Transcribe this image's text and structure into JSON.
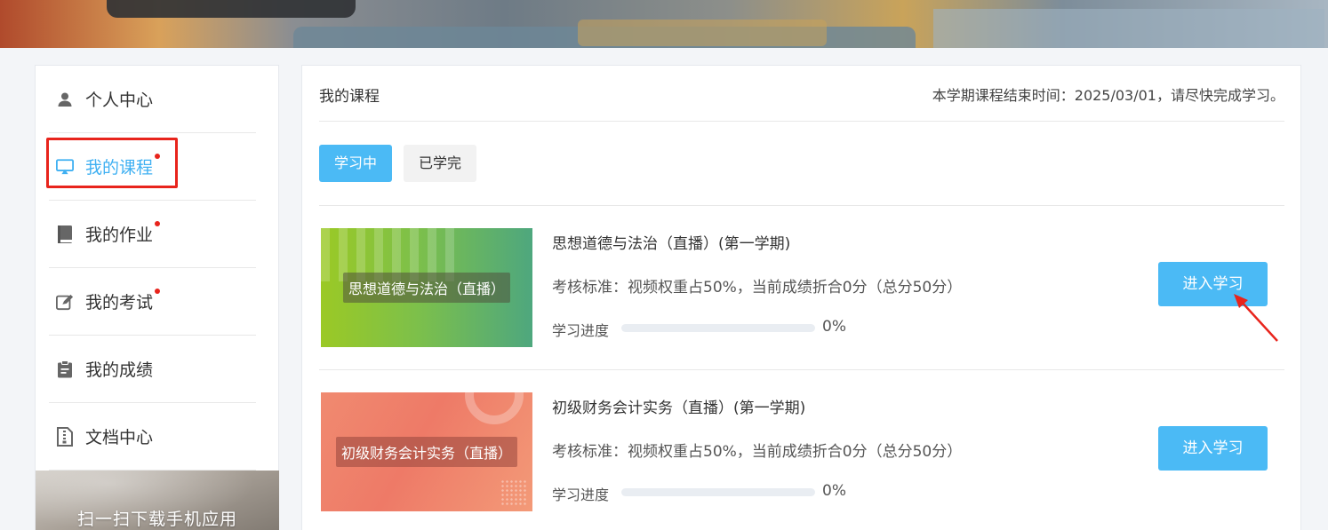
{
  "sidebar": {
    "items": [
      {
        "label": "个人中心",
        "icon": "user-icon",
        "active": false,
        "badge": false
      },
      {
        "label": "我的课程",
        "icon": "screen-icon",
        "active": true,
        "badge": true
      },
      {
        "label": "我的作业",
        "icon": "book-icon",
        "active": false,
        "badge": true
      },
      {
        "label": "我的考试",
        "icon": "edit-icon",
        "active": false,
        "badge": true
      },
      {
        "label": "我的成绩",
        "icon": "clipboard-icon",
        "active": false,
        "badge": false
      },
      {
        "label": "文档中心",
        "icon": "document-icon",
        "active": false,
        "badge": false
      }
    ],
    "qr_text": "扫一扫下载手机应用"
  },
  "main": {
    "title": "我的课程",
    "term_note": "本学期课程结束时间：2025/03/01，请尽快完成学习。",
    "tabs": [
      {
        "label": "学习中",
        "active": true
      },
      {
        "label": "已学完",
        "active": false
      }
    ],
    "courses": [
      {
        "thumb_label": "思想道德与法治（直播）",
        "title": "思想道德与法治（直播）(第一学期)",
        "standard": "考核标准：视频权重占50%，当前成绩折合0分（总分50分）",
        "progress_label": "学习进度",
        "progress": 0,
        "progress_text": "0%",
        "button": "进入学习"
      },
      {
        "thumb_label": "初级财务会计实务（直播）",
        "title": "初级财务会计实务（直播）(第一学期)",
        "standard": "考核标准：视频权重占50%，当前成绩折合0分（总分50分）",
        "progress_label": "学习进度",
        "progress": 0,
        "progress_text": "0%",
        "button": "进入学习"
      }
    ]
  },
  "colors": {
    "accent": "#4bbaf5",
    "highlight": "#e8241c",
    "badge": "#e8241c"
  }
}
